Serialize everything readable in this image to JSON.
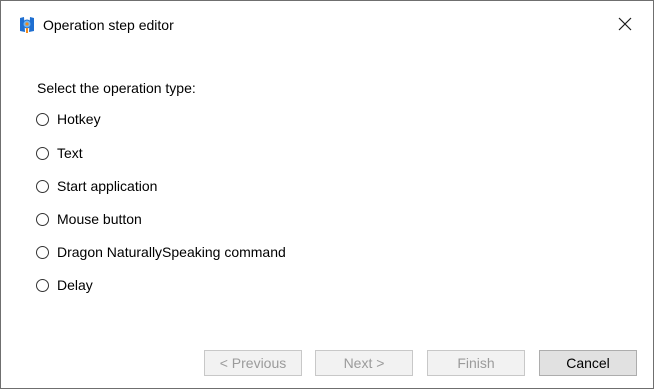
{
  "window": {
    "title": "Operation step editor",
    "icons": {
      "app": "dragon-app-icon",
      "close": "close-icon"
    }
  },
  "main": {
    "prompt": "Select the operation type:",
    "options": [
      {
        "label": "Hotkey",
        "selected": false
      },
      {
        "label": "Text",
        "selected": false
      },
      {
        "label": "Start application",
        "selected": false
      },
      {
        "label": "Mouse button",
        "selected": false
      },
      {
        "label": "Dragon NaturallySpeaking command",
        "selected": false
      },
      {
        "label": "Delay",
        "selected": false
      }
    ]
  },
  "footer": {
    "previous_label": "< Previous",
    "next_label": "Next >",
    "finish_label": "Finish",
    "cancel_label": "Cancel",
    "previous_enabled": false,
    "next_enabled": false,
    "finish_enabled": false,
    "cancel_enabled": true
  },
  "colors": {
    "disabled_text": "#9b9b9b",
    "button_face": "#e1e1e1",
    "app_icon_blue": "#1f6fd1",
    "app_icon_orange": "#f08a1c"
  }
}
